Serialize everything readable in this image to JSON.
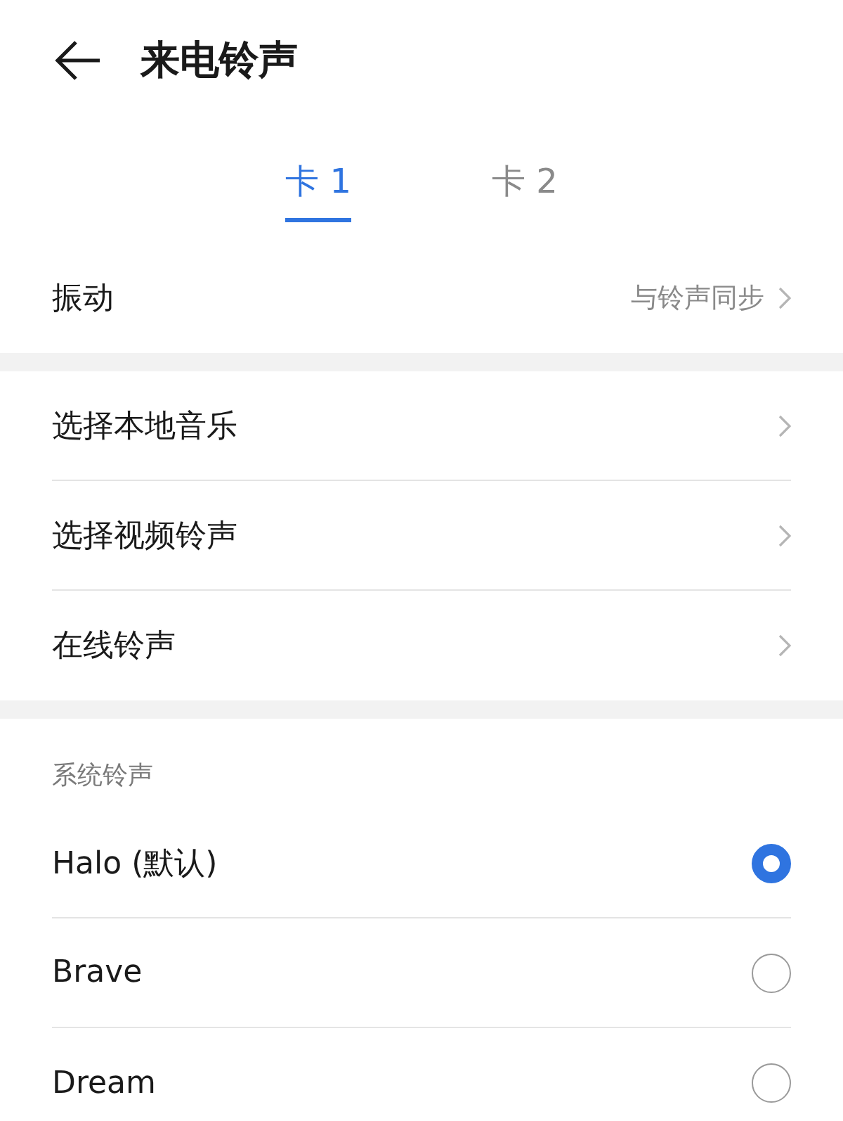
{
  "header": {
    "title": "来电铃声"
  },
  "tabs": [
    {
      "label": "卡 1",
      "selected": true
    },
    {
      "label": "卡 2",
      "selected": false
    }
  ],
  "vibration": {
    "label": "振动",
    "value": "与铃声同步"
  },
  "menu_items": [
    {
      "label": "选择本地音乐"
    },
    {
      "label": "选择视频铃声"
    },
    {
      "label": "在线铃声"
    }
  ],
  "system_ringtones": {
    "heading": "系统铃声",
    "items": [
      {
        "label": "Halo (默认)",
        "selected": true
      },
      {
        "label": "Brave",
        "selected": false
      },
      {
        "label": "Dream",
        "selected": false
      }
    ]
  }
}
